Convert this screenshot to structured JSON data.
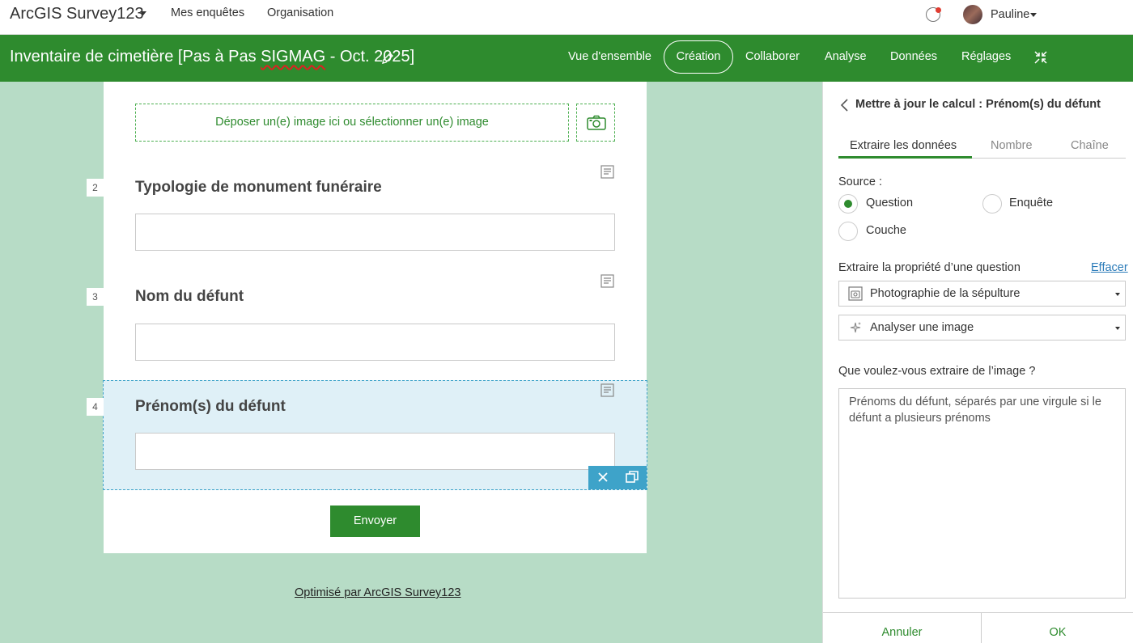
{
  "app": {
    "title": "ArcGIS Survey123",
    "nav": [
      "Mes enquêtes",
      "Organisation"
    ],
    "user": "Pauline"
  },
  "survey": {
    "title_prefix": "Inventaire de cimetière [Pas à Pas ",
    "title_underlined": "SIGMAG",
    "title_suffix": " - Oct. 2025]",
    "tabs": [
      "Vue d'ensemble",
      "Création",
      "Collaborer",
      "Analyse",
      "Données",
      "Réglages"
    ],
    "active_tab": "Création"
  },
  "form": {
    "image_drop_text": "Déposer un(e) image ici ou sélectionner un(e) image",
    "questions": [
      {
        "number": "2",
        "title": "Typologie de monument funéraire"
      },
      {
        "number": "3",
        "title": "Nom du défunt"
      },
      {
        "number": "4",
        "title": "Prénom(s) du défunt"
      }
    ],
    "submit_label": "Envoyer",
    "powered_by": "Optimisé par ArcGIS Survey123"
  },
  "panel": {
    "title": "Mettre à jour le calcul : Prénom(s) du défunt",
    "tabs": [
      "Extraire les données",
      "Nombre",
      "Chaîne"
    ],
    "source_label": "Source :",
    "source_options": [
      "Question",
      "Enquête",
      "Couche"
    ],
    "source_selected": "Question",
    "extract_label": "Extraire la propriété d’une question",
    "clear_label": "Effacer",
    "question_select": "Photographie de la sépulture",
    "action_select": "Analyser une image",
    "prompt_label": "Que voulez-vous extraire de l’image ?",
    "prompt_placeholder": "Prénoms du défunt, séparés par une virgule si le défunt a plusieurs prénoms",
    "cancel_label": "Annuler",
    "ok_label": "OK"
  },
  "colors": {
    "brand_green": "#2e8b2e",
    "canvas_bg": "#b7dcc6",
    "selection_blue": "#3ea3c9",
    "link_blue": "#2b7bb9"
  }
}
